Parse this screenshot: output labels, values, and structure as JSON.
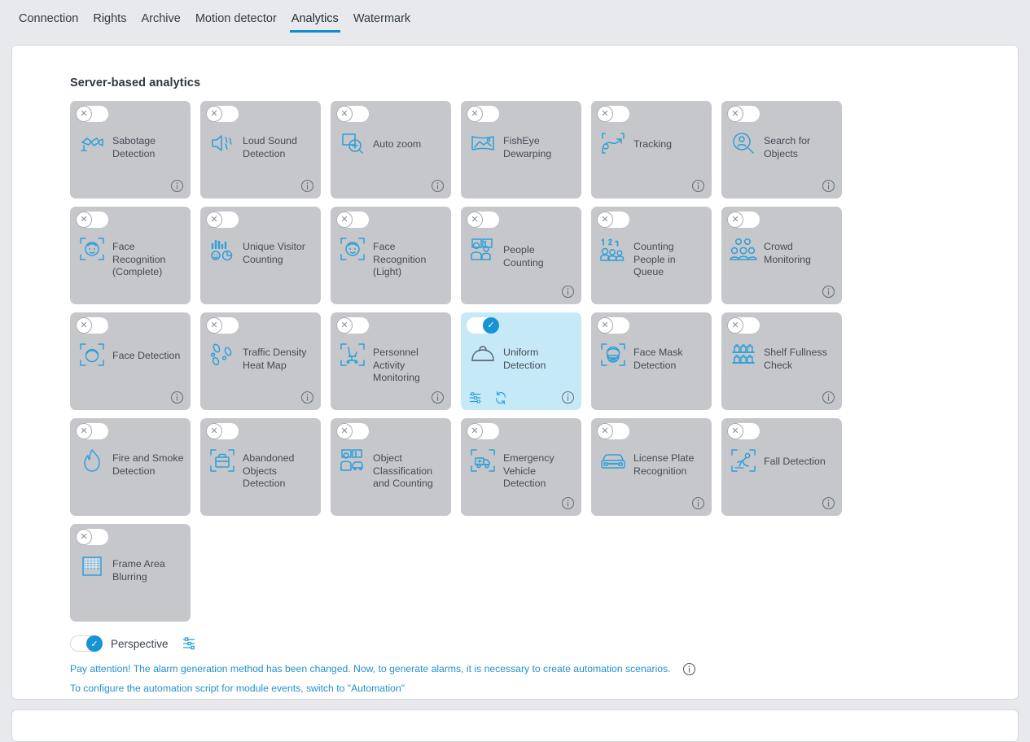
{
  "tabs": [
    {
      "label": "Connection",
      "active": false
    },
    {
      "label": "Rights",
      "active": false
    },
    {
      "label": "Archive",
      "active": false
    },
    {
      "label": "Motion detector",
      "active": false
    },
    {
      "label": "Analytics",
      "active": true
    },
    {
      "label": "Watermark",
      "active": false
    }
  ],
  "colors": {
    "accent": "#1794d4",
    "icon_blue": "#2e9fd8",
    "card_bg": "#c6c7cb",
    "card_bg_active": "#c6e9f8",
    "page_bg": "#e7e9ec",
    "link": "#2490cf"
  },
  "section": {
    "title": "Server-based analytics"
  },
  "toggle_glyphs": {
    "off": "✕",
    "on": "✓"
  },
  "cards": [
    [
      {
        "label": "Sabotage Detection",
        "icon": "sabotage-camera-icon",
        "enabled": false,
        "info": true
      },
      {
        "label": "Loud Sound Detection",
        "icon": "speaker-sound-icon",
        "enabled": false,
        "info": true
      },
      {
        "label": "Auto zoom",
        "icon": "magnifier-plus-icon",
        "enabled": false,
        "info": true
      },
      {
        "label": "FishEye Dewarping",
        "icon": "fisheye-panorama-icon",
        "enabled": false,
        "info": false
      },
      {
        "label": "Tracking",
        "icon": "tracking-path-icon",
        "enabled": false,
        "info": true
      },
      {
        "label": "Search for Objects",
        "icon": "person-magnifier-icon",
        "enabled": false,
        "info": true
      }
    ],
    [
      {
        "label": "Face Recognition (Complete)",
        "icon": "face-brackets-icon",
        "enabled": false,
        "info": false
      },
      {
        "label": "Unique Visitor Counting",
        "icon": "bars-face-pie-icon",
        "enabled": false,
        "info": false
      },
      {
        "label": "Face Recognition (Light)",
        "icon": "face-brackets-icon",
        "enabled": false,
        "info": false
      },
      {
        "label": "People Counting",
        "icon": "people-count-box-icon",
        "enabled": false,
        "info": true
      },
      {
        "label": "Counting People in Queue",
        "icon": "queue-numbers-icon",
        "enabled": false,
        "info": false
      },
      {
        "label": "Crowd Monitoring",
        "icon": "crowd-icon",
        "enabled": false,
        "info": true
      }
    ],
    [
      {
        "label": "Face Detection",
        "icon": "face-detect-brackets-icon",
        "enabled": false,
        "info": true
      },
      {
        "label": "Traffic Density Heat Map",
        "icon": "footprints-icon",
        "enabled": false,
        "info": true
      },
      {
        "label": "Personnel Activity Monitoring",
        "icon": "office-chair-brackets-icon",
        "enabled": false,
        "info": true
      },
      {
        "label": "Uniform Detection",
        "icon": "hard-hat-icon",
        "enabled": true,
        "info": true,
        "tools": [
          "settings-sliders-icon",
          "refresh-icon"
        ]
      },
      {
        "label": "Face Mask Detection",
        "icon": "face-mask-brackets-icon",
        "enabled": false,
        "info": false
      },
      {
        "label": "Shelf Fullness Check",
        "icon": "shelf-bottles-icon",
        "enabled": false,
        "info": true
      }
    ],
    [
      {
        "label": "Fire and Smoke Detection",
        "icon": "flame-icon",
        "enabled": false,
        "info": false
      },
      {
        "label": "Abandoned Objects Detection",
        "icon": "suitcase-brackets-icon",
        "enabled": false,
        "info": false
      },
      {
        "label": "Object Classification and Counting",
        "icon": "object-class-count-icon",
        "enabled": false,
        "info": false
      },
      {
        "label": "Emergency Vehicle Detection",
        "icon": "ambulance-brackets-icon",
        "enabled": false,
        "info": true
      },
      {
        "label": "License Plate Recognition",
        "icon": "car-front-icon",
        "enabled": false,
        "info": true
      },
      {
        "label": "Fall Detection",
        "icon": "falling-person-brackets-icon",
        "enabled": false,
        "info": true
      }
    ],
    [
      {
        "label": "Frame Area Blurring",
        "icon": "blur-area-icon",
        "enabled": false,
        "info": false
      }
    ]
  ],
  "perspective": {
    "label": "Perspective",
    "enabled": true,
    "settings_icon": "settings-sliders-icon"
  },
  "notes": [
    {
      "text": "Pay attention! The alarm generation method has been changed. Now, to generate alarms, it is necessary to create automation scenarios.",
      "info": true
    },
    {
      "text": "To configure the automation script for module events, switch to \"Automation\"",
      "info": false
    }
  ]
}
